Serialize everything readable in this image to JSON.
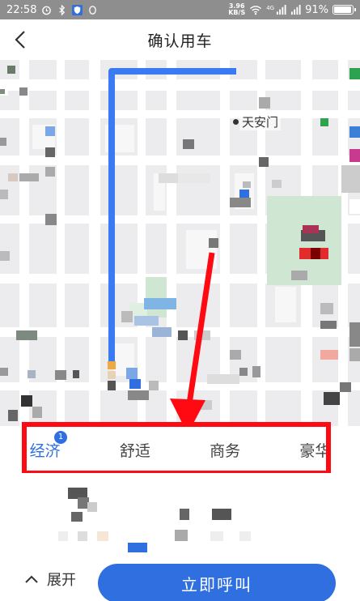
{
  "status_bar": {
    "time": "22:58",
    "net_speed_value": "3.96",
    "net_speed_unit": "KB/S",
    "network": "4G",
    "battery": "91%"
  },
  "header": {
    "title": "确认用车"
  },
  "map": {
    "place_label": "天安门",
    "route_color": "#3a7af2",
    "park_color": "#cfe6d3",
    "annotation_color": "#ff0a12"
  },
  "tabs": [
    {
      "label": "经济",
      "badge": "1",
      "active": true
    },
    {
      "label": "舒适",
      "active": false
    },
    {
      "label": "商务",
      "active": false
    },
    {
      "label": "豪华",
      "active": false
    }
  ],
  "bottom": {
    "expand_label": "展开",
    "call_label": "立即呼叫"
  },
  "colors": {
    "accent": "#2f6fe0",
    "highlight": "#ff0a12"
  }
}
